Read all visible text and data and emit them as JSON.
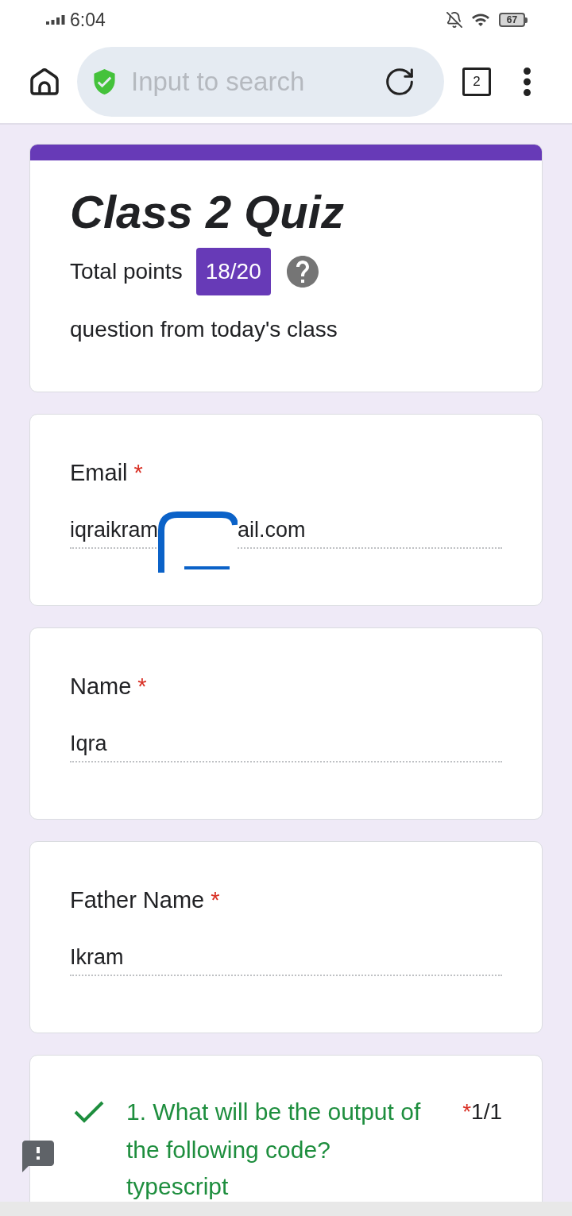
{
  "status_bar": {
    "time": "6:04",
    "battery": "67"
  },
  "browser_bar": {
    "search": {
      "placeholder": "Input to search"
    },
    "tab_count": "2"
  },
  "quiz_header": {
    "title": "Class 2 Quiz",
    "points_label": "Total points",
    "score": "18/20",
    "description": "question from today's class"
  },
  "fields": [
    {
      "label": "Email",
      "required_mark": "*",
      "value_parts": [
        "iqraikram",
        "ail.com"
      ]
    },
    {
      "label": "Name",
      "required_mark": "*",
      "value_parts": [
        "Iqra"
      ]
    },
    {
      "label": "Father Name",
      "required_mark": "*",
      "value_parts": [
        "Ikram"
      ]
    }
  ],
  "questions": [
    {
      "text": "1. What will be the output of the following code?",
      "correct": true,
      "required_mark": "*",
      "points": "1/1",
      "description": "typescript"
    }
  ]
}
